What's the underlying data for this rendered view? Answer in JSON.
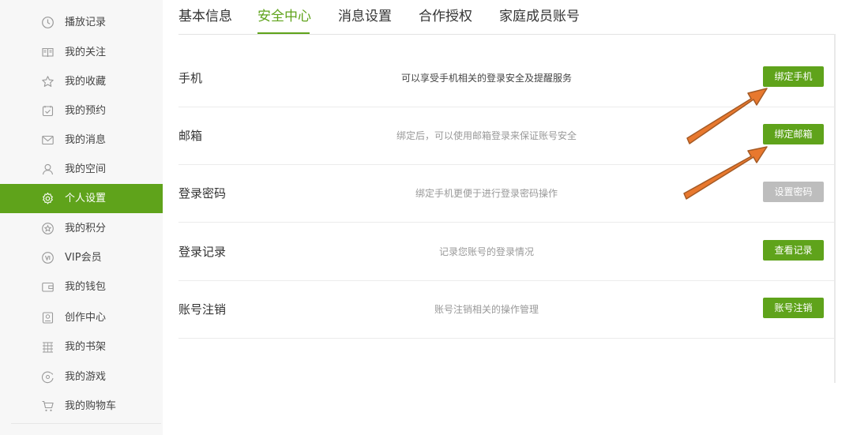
{
  "sidebar": {
    "items": [
      {
        "label": "播放记录",
        "icon": "clock-icon"
      },
      {
        "label": "我的关注",
        "icon": "book-icon"
      },
      {
        "label": "我的收藏",
        "icon": "star-icon"
      },
      {
        "label": "我的预约",
        "icon": "calendar-check-icon"
      },
      {
        "label": "我的消息",
        "icon": "envelope-icon"
      },
      {
        "label": "我的空间",
        "icon": "user-icon"
      },
      {
        "label": "个人设置",
        "icon": "gear-icon"
      },
      {
        "label": "我的积分",
        "icon": "medal-icon"
      },
      {
        "label": "VIP会员",
        "icon": "vip-icon"
      },
      {
        "label": "我的钱包",
        "icon": "wallet-icon"
      },
      {
        "label": "创作中心",
        "icon": "creator-icon"
      },
      {
        "label": "我的书架",
        "icon": "bookshelf-icon"
      },
      {
        "label": "我的游戏",
        "icon": "gamepad-icon"
      },
      {
        "label": "我的购物车",
        "icon": "cart-icon"
      }
    ],
    "active_index": 6
  },
  "tabs": [
    {
      "label": "基本信息"
    },
    {
      "label": "安全中心"
    },
    {
      "label": "消息设置"
    },
    {
      "label": "合作授权"
    },
    {
      "label": "家庭成员账号"
    }
  ],
  "active_tab": 1,
  "security_rows": [
    {
      "title": "手机",
      "description": "可以享受手机相关的登录安全及提醒服务",
      "button": "绑定手机",
      "button_enabled": true
    },
    {
      "title": "邮箱",
      "description": "绑定后，可以使用邮箱登录来保证账号安全",
      "button": "绑定邮箱",
      "button_enabled": true
    },
    {
      "title": "登录密码",
      "description": "绑定手机更便于进行登录密码操作",
      "button": "设置密码",
      "button_enabled": false
    },
    {
      "title": "登录记录",
      "description": "记录您账号的登录情况",
      "button": "查看记录",
      "button_enabled": true
    },
    {
      "title": "账号注销",
      "description": "账号注销相关的操作管理",
      "button": "账号注销",
      "button_enabled": true
    }
  ],
  "colors": {
    "accent": "#5fa31b",
    "disabled_button": "#bdbdbd",
    "annotation_arrow": "#e8782e"
  }
}
